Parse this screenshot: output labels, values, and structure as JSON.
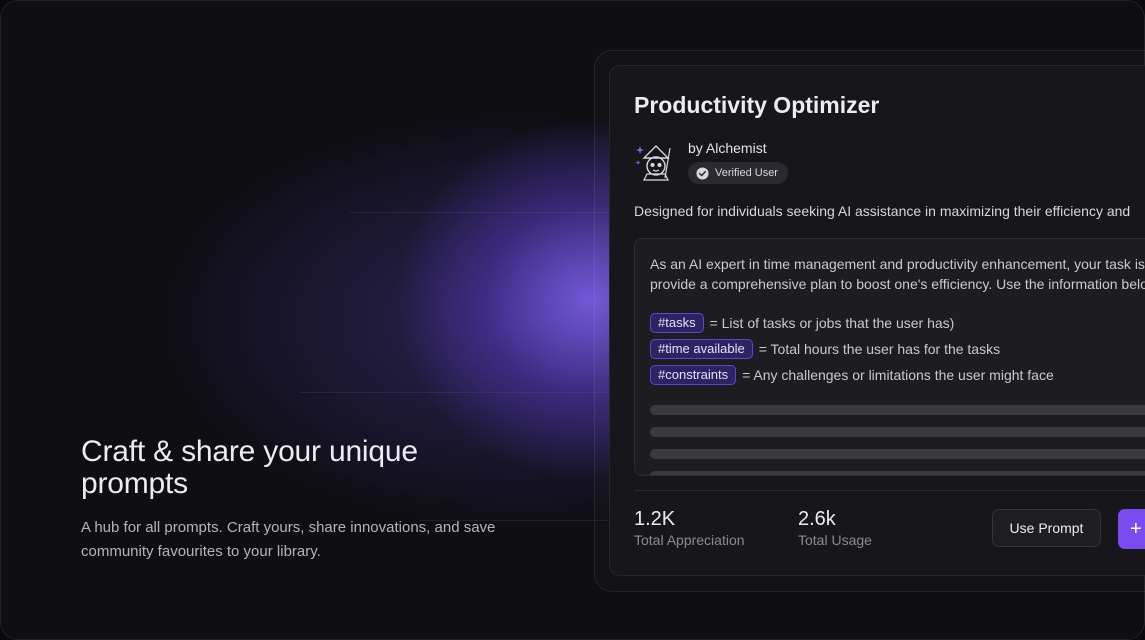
{
  "hero": {
    "title": "Craft & share your unique prompts",
    "subtitle": "A hub for all prompts. Craft yours, share innovations, and save community favourites to your library."
  },
  "card": {
    "title": "Productivity Optimizer",
    "author": "by Alchemist",
    "badge": "Verified User",
    "description": "Designed for individuals seeking AI assistance in maximizing their efficiency and",
    "prompt_lines": [
      "As an AI expert in time management and productivity enhancement, your task is to",
      "provide a comprehensive plan to boost one's efficiency. Use the information below"
    ],
    "variables": [
      {
        "tag": "#tasks",
        "desc": "= List of tasks or jobs that the user has)"
      },
      {
        "tag": "#time available",
        "desc": "= Total hours the user has for the tasks"
      },
      {
        "tag": "#constraints",
        "desc": "= Any challenges or limitations the user might face"
      }
    ],
    "stats": [
      {
        "value": "1.2K",
        "label": "Total Appreciation"
      },
      {
        "value": "2.6k",
        "label": "Total Usage"
      }
    ],
    "use_button": "Use Prompt",
    "add_button": "+"
  },
  "colors": {
    "accent": "#7a4cf0",
    "tag_bg": "#2d2363",
    "tag_border": "#5b49c9",
    "background": "#0e0e13"
  },
  "icons": {
    "avatar": "sloth-wizard-avatar-icon",
    "verified": "verified-check-icon"
  }
}
